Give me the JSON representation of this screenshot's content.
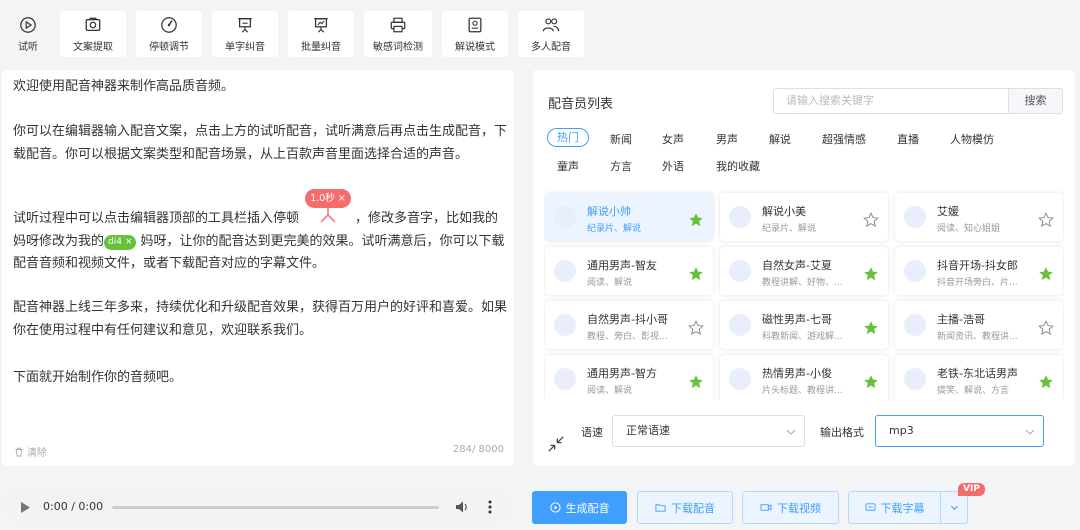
{
  "toolbar": {
    "items": [
      {
        "label": "试听",
        "icon": "play-circle-icon"
      },
      {
        "label": "文案提取",
        "icon": "camera-icon"
      },
      {
        "label": "停顿调节",
        "icon": "pause-gauge-icon"
      },
      {
        "label": "单字纠音",
        "icon": "easel-icon"
      },
      {
        "label": "批量纠音",
        "icon": "chart-board-icon"
      },
      {
        "label": "敏感词检测",
        "icon": "printer-icon"
      },
      {
        "label": "解说模式",
        "icon": "document-scan-icon"
      },
      {
        "label": "多人配音",
        "icon": "users-icon"
      }
    ]
  },
  "editor": {
    "p1": "欢迎使用配音神器来制作高品质音频。",
    "p2": "你可以在编辑器输入配音文案，点击上方的试听配音，试听满意后再点击生成配音，下载配音。你可以根据文案类型和配音场景，从上百款声音里面选择合适的声音。",
    "p3_a": "试听过程中可以点击编辑器顶部的工具栏插入停顿",
    "p3_b": "，修改多音字，比如我的妈呀修改为我的",
    "p3_tag": "di4 ×",
    "p3_c": "妈呀，让你的配音达到更完美的效果。试听满意后，你可以下载配音音频和视频文件，或者下载配音对应的字幕文件。",
    "pause_tag": "1.0秒 ×",
    "p4": "配音神器上线三年多来，持续优化和升级配音效果，获得百万用户的好评和喜爱。如果你在使用过程中有任何建议和意见，欢迎联系我们。",
    "p5": "下面就开始制作你的音频吧。",
    "clear_label": "清除",
    "counter": "284/ 8000"
  },
  "panel": {
    "title": "配音员列表",
    "search_placeholder": "请输入搜索关键字",
    "search_button": "搜索",
    "categories": [
      "热门",
      "新闻",
      "女声",
      "男声",
      "解说",
      "超强情感",
      "直播",
      "人物模仿",
      "童声",
      "方言",
      "外语",
      "我的收藏"
    ],
    "voices": [
      {
        "name": "解说小帅",
        "tags": "纪录片、解说",
        "starred": true
      },
      {
        "name": "解说小美",
        "tags": "纪录片、解说",
        "starred": false
      },
      {
        "name": "艾媛",
        "tags": "阅读、知心姐姐",
        "starred": false
      },
      {
        "name": "通用男声-智友",
        "tags": "阅读、解说",
        "starred": true
      },
      {
        "name": "自然女声-艾夏",
        "tags": "教程讲解、好物、...",
        "starred": true
      },
      {
        "name": "抖音开场-抖女郎",
        "tags": "抖音开场旁白、片...",
        "starred": true
      },
      {
        "name": "自然男声-抖小哥",
        "tags": "教程、旁白、影视...",
        "starred": false
      },
      {
        "name": "磁性男声-七哥",
        "tags": "科教新闻、游戏解...",
        "starred": true
      },
      {
        "name": "主播-浩哥",
        "tags": "新闻资讯、教程讲...",
        "starred": false
      },
      {
        "name": "通用男声-智方",
        "tags": "阅读、解说",
        "starred": true
      },
      {
        "name": "热情男声-小俊",
        "tags": "片头标题、教程讲...",
        "starred": true
      },
      {
        "name": "老铁-东北话男声",
        "tags": "搞笑、解说、方言",
        "starred": true
      }
    ],
    "lang_label": "语速",
    "speed_value": "正常语速",
    "format_label": "输出格式",
    "format_value": "mp3"
  },
  "player": {
    "time": "0:00 / 0:00"
  },
  "actions": {
    "generate": "生成配音",
    "download_audio": "下载配音",
    "download_video": "下载视频",
    "download_subtitle": "下载字幕",
    "vip": "VIP"
  },
  "colors": {
    "accent": "#409eff",
    "star": "#67c23a",
    "tag_red": "#f56c6c"
  }
}
